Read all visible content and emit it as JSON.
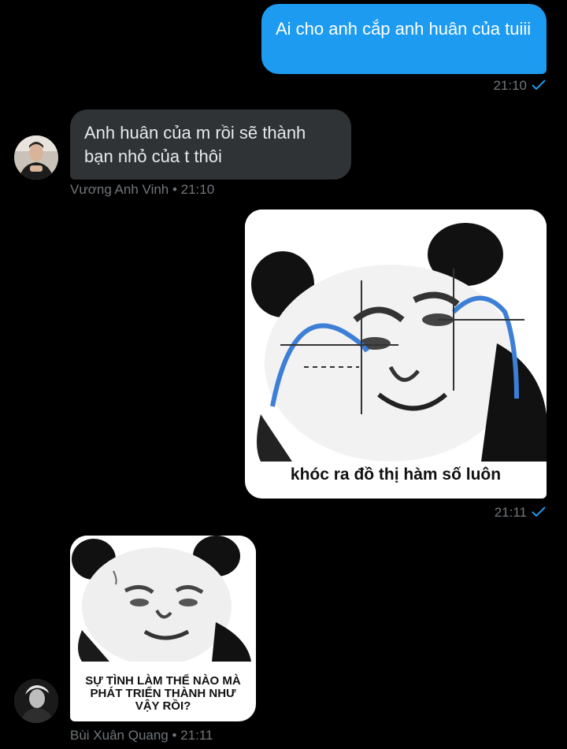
{
  "messages": [
    {
      "text": "Ai cho anh cắp anh huân của tuiii",
      "time": "21:10"
    },
    {
      "text": "Anh huân của m rồi sẽ thành bạn nhỏ của t thôi",
      "sender": "Vương Anh Vinh",
      "time": "21:10",
      "meta": "Vương Anh Vinh • 21:10"
    },
    {
      "caption": "khóc ra đồ thị hàm số luôn",
      "time": "21:11"
    },
    {
      "caption": "SỰ TÌNH LÀM THẾ NÀO MÀ PHÁT TRIỂN THÀNH NHƯ VẬY RỒI?",
      "sender": "Bùi Xuân Quang",
      "time": "21:11",
      "meta": "Bùi Xuân Quang • 21:11"
    }
  ],
  "colors": {
    "background": "#000000",
    "outgoing_bubble": "#1d9bf0",
    "incoming_bubble": "#2f3336",
    "meta_text": "#71767b",
    "read_check": "#1d9bf0"
  },
  "icons": {
    "read_receipt": "checkmark-icon"
  }
}
